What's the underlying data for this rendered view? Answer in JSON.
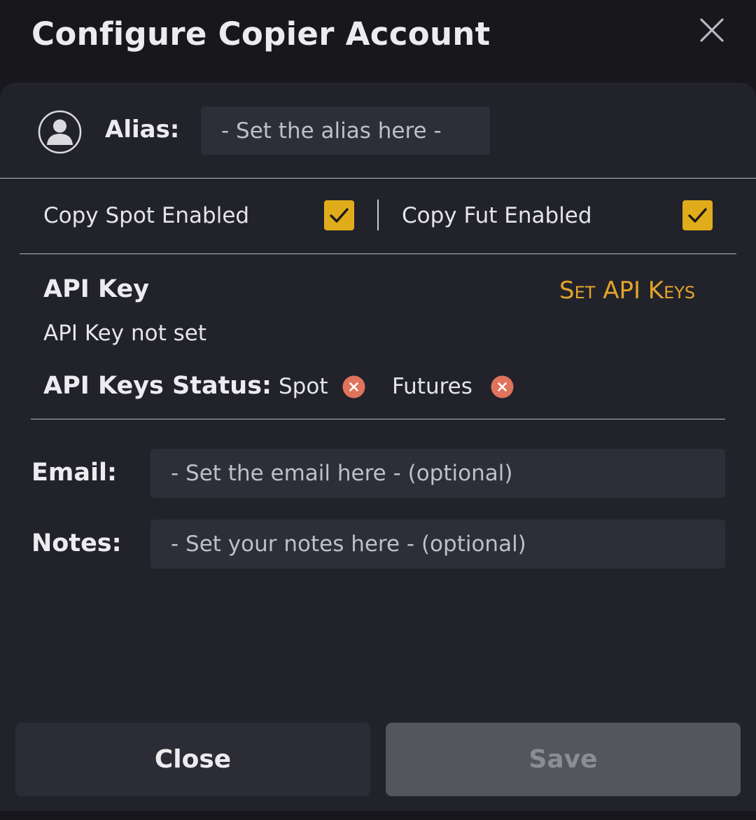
{
  "dialog": {
    "title": "Configure Copier Account"
  },
  "alias": {
    "label": "Alias:",
    "placeholder": "- Set the alias here -"
  },
  "copy_toggles": {
    "spot": {
      "label": "Copy Spot Enabled",
      "checked": true
    },
    "futures": {
      "label": "Copy Fut Enabled",
      "checked": true
    }
  },
  "api": {
    "title": "API Key",
    "set_link": "Set API Keys",
    "key_status_text": "API Key not set",
    "status_label": "API Keys Status:",
    "spot_label": "Spot",
    "futures_label": "Futures"
  },
  "email": {
    "label": "Email:",
    "placeholder": "- Set the email here - (optional)"
  },
  "notes": {
    "label": "Notes:",
    "placeholder": "- Set your notes here - (optional)"
  },
  "buttons": {
    "close": "Close",
    "save": "Save"
  },
  "colors": {
    "accent": "#e1ac1a",
    "link": "#e1a52a",
    "error": "#e0735c",
    "background": "#22222b",
    "input": "#2e2e38"
  },
  "icons": {
    "close": "close-icon",
    "avatar": "user-avatar-icon",
    "check": "checkmark-icon",
    "status_error": "error-x-circle-icon"
  }
}
